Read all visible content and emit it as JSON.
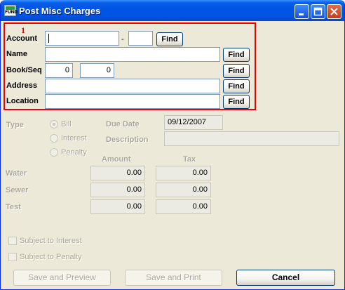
{
  "window": {
    "title": "Post Misc Charges",
    "app_icon_text": "FUND"
  },
  "annotation": {
    "marker": "1"
  },
  "fields": {
    "account": {
      "label": "Account",
      "value": "",
      "separator": "-",
      "suffix_value": "",
      "find_label": "Find"
    },
    "name": {
      "label": "Name",
      "value": "",
      "find_label": "Find"
    },
    "book_seq": {
      "label": "Book/Seq",
      "book": "0",
      "seq": "0",
      "find_label": "Find"
    },
    "address": {
      "label": "Address",
      "value": "",
      "find_label": "Find"
    },
    "location": {
      "label": "Location",
      "value": "",
      "find_label": "Find"
    }
  },
  "type_section": {
    "label": "Type",
    "options": [
      "Bill",
      "Interest",
      "Penalty"
    ],
    "selected": "Bill"
  },
  "due_date": {
    "label": "Due Date",
    "value": "09/12/2007"
  },
  "description": {
    "label": "Description",
    "value": ""
  },
  "charges": {
    "amount_header": "Amount",
    "tax_header": "Tax",
    "rows": [
      {
        "label": "Water",
        "amount": "0.00",
        "tax": "0.00"
      },
      {
        "label": "Sewer",
        "amount": "0.00",
        "tax": "0.00"
      },
      {
        "label": "Test",
        "amount": "0.00",
        "tax": "0.00"
      }
    ]
  },
  "checkboxes": {
    "subject_interest": "Subject to Interest",
    "subject_penalty": "Subject to Penalty"
  },
  "buttons": {
    "save_preview": "Save and Preview",
    "save_print": "Save and Print",
    "cancel": "Cancel"
  }
}
